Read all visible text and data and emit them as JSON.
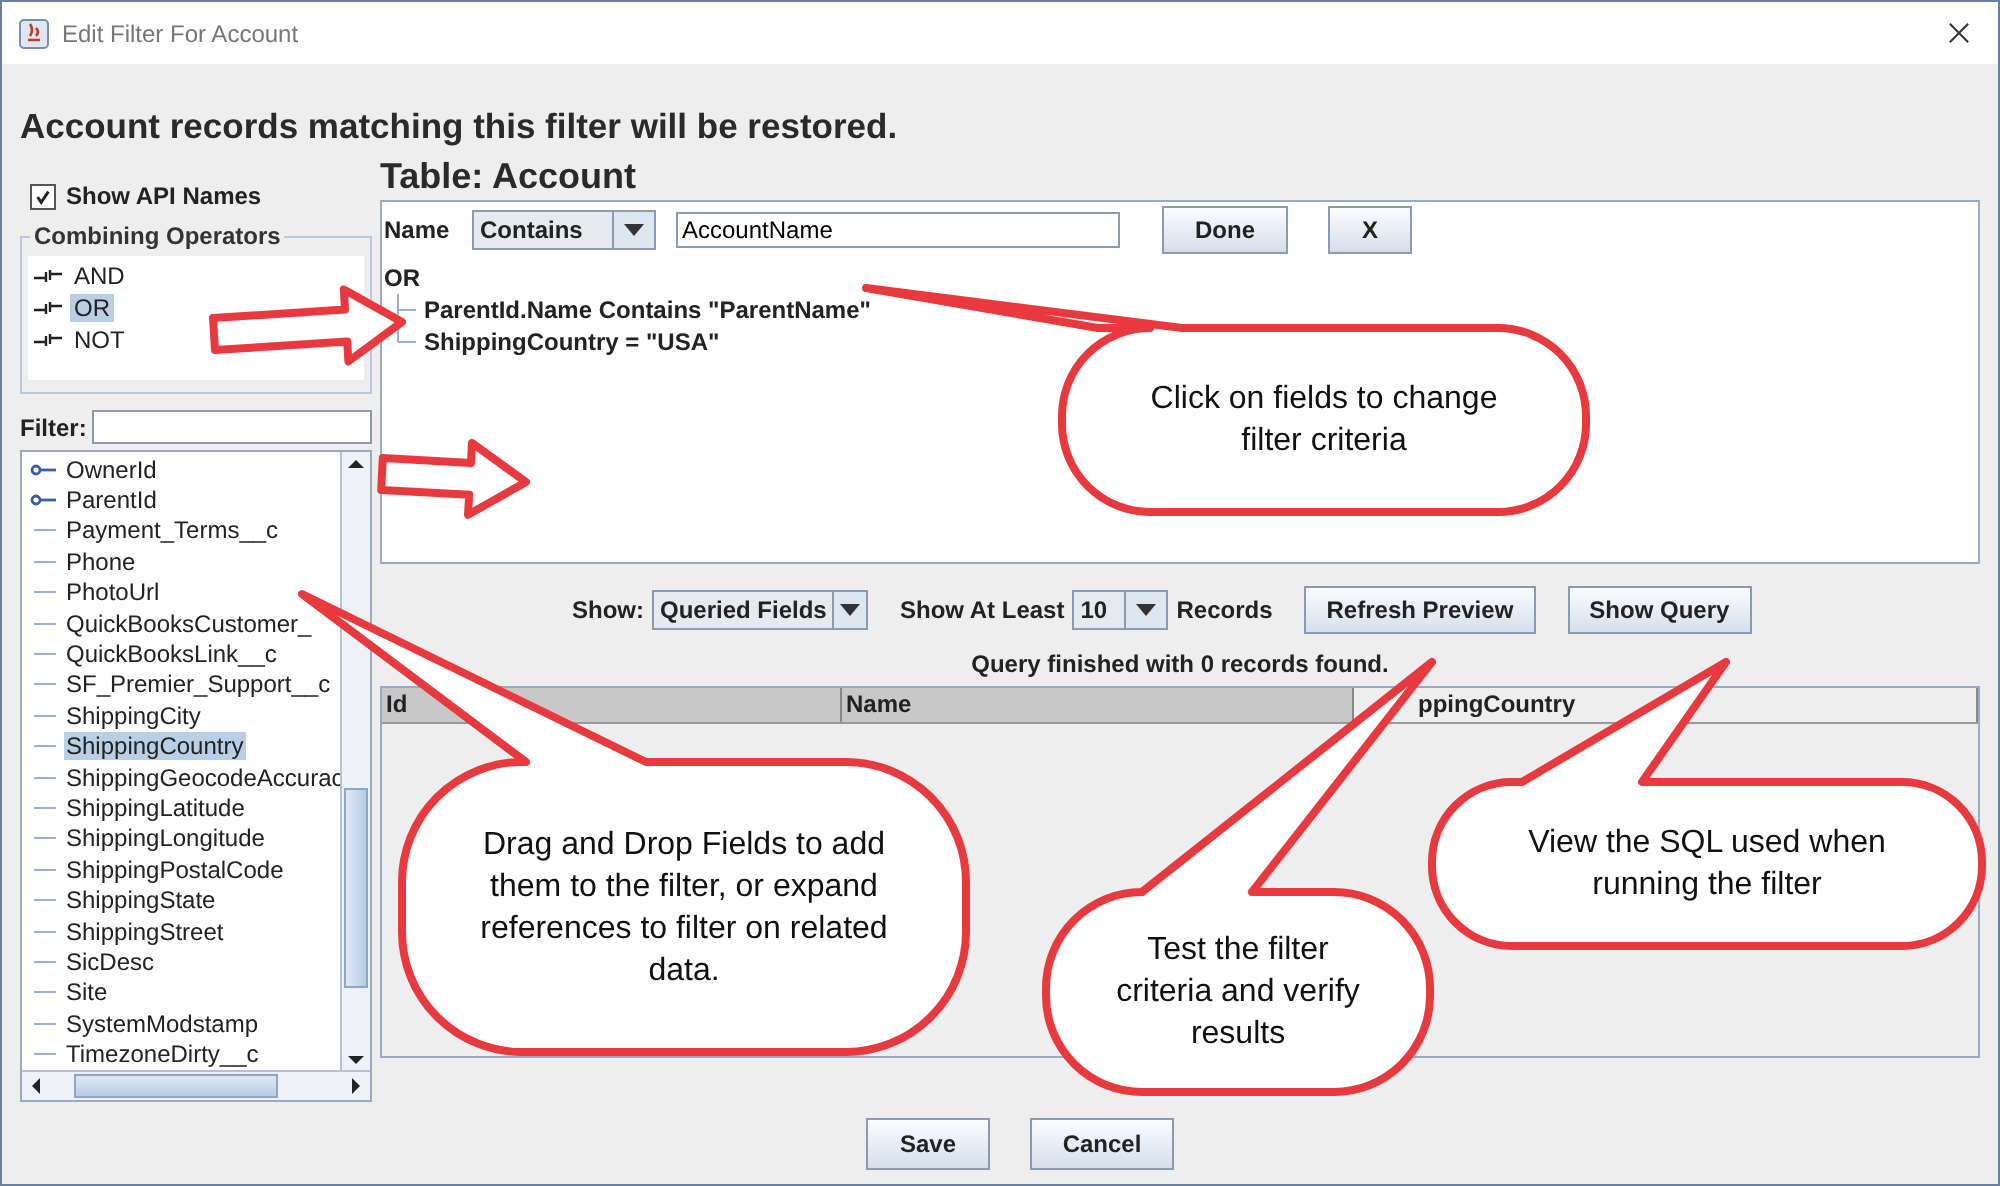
{
  "window": {
    "title": "Edit Filter For Account"
  },
  "heading": "Account records matching this filter will be restored.",
  "show_api_names": {
    "label": "Show API Names",
    "checked": true
  },
  "combining_operators": {
    "title": "Combining Operators",
    "items": [
      {
        "label": "AND",
        "selected": false
      },
      {
        "label": "OR",
        "selected": true
      },
      {
        "label": "NOT",
        "selected": false
      }
    ]
  },
  "filter": {
    "label": "Filter:"
  },
  "fields": [
    {
      "label": "OwnerId",
      "kind": "reference",
      "selected": false
    },
    {
      "label": "ParentId",
      "kind": "reference",
      "selected": false
    },
    {
      "label": "Payment_Terms__c",
      "kind": "field",
      "selected": false
    },
    {
      "label": "Phone",
      "kind": "field",
      "selected": false
    },
    {
      "label": "PhotoUrl",
      "kind": "field",
      "selected": false
    },
    {
      "label": "QuickBooksCustomer_",
      "kind": "field",
      "selected": false
    },
    {
      "label": "QuickBooksLink__c",
      "kind": "field",
      "selected": false
    },
    {
      "label": "SF_Premier_Support__c",
      "kind": "field",
      "selected": false
    },
    {
      "label": "ShippingCity",
      "kind": "field",
      "selected": false
    },
    {
      "label": "ShippingCountry",
      "kind": "field",
      "selected": true
    },
    {
      "label": "ShippingGeocodeAccurac",
      "kind": "field",
      "selected": false
    },
    {
      "label": "ShippingLatitude",
      "kind": "field",
      "selected": false
    },
    {
      "label": "ShippingLongitude",
      "kind": "field",
      "selected": false
    },
    {
      "label": "ShippingPostalCode",
      "kind": "field",
      "selected": false
    },
    {
      "label": "ShippingState",
      "kind": "field",
      "selected": false
    },
    {
      "label": "ShippingStreet",
      "kind": "field",
      "selected": false
    },
    {
      "label": "SicDesc",
      "kind": "field",
      "selected": false
    },
    {
      "label": "Site",
      "kind": "field",
      "selected": false
    },
    {
      "label": "SystemModstamp",
      "kind": "field",
      "selected": false
    },
    {
      "label": "TimezoneDirty__c",
      "kind": "field",
      "selected": false
    }
  ],
  "table_title": "Table: Account",
  "editor": {
    "field_label": "Name",
    "operator": "Contains",
    "value": "AccountName",
    "buttons": [
      "Done",
      "X"
    ]
  },
  "criteria": {
    "operator": "OR",
    "children": [
      {
        "label": "ParentId.Name Contains \"ParentName\""
      },
      {
        "label": "ShippingCountry = \"USA\""
      }
    ]
  },
  "preview": {
    "show_label": "Show:",
    "show_value": "Queried Fields",
    "at_least_label": "Show At Least",
    "count": "10",
    "records_label": "Records",
    "buttons": [
      "Refresh Preview",
      "Show Query"
    ],
    "status": "Query finished with 0 records found.",
    "columns": [
      "Id",
      "Name",
      "ppingCountry"
    ]
  },
  "footer_buttons": [
    "Save",
    "Cancel"
  ],
  "callouts": [
    {
      "text": "Click on fields to change filter criteria"
    },
    {
      "text": "Drag and Drop Fields to add them to the filter, or expand references to filter on related data."
    },
    {
      "text": "Test the filter criteria and verify results"
    },
    {
      "text": "View the SQL used when running the filter"
    }
  ]
}
